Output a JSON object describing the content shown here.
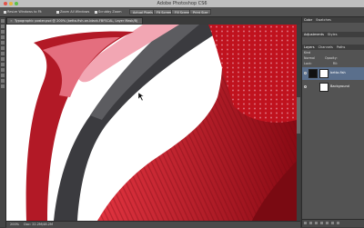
{
  "app": {
    "title": "Adobe Photoshop CS6"
  },
  "options_bar": {
    "resize_windows": "Resize Windows to Fit",
    "zoom_all_windows": "Zoom All Windows",
    "scrubby_zoom": "Scrubby Zoom",
    "actual_pixels": "Actual Pixels",
    "fit_screen": "Fit Screen",
    "fill_screen": "Fill Screen",
    "print_size": "Print Size"
  },
  "document": {
    "tab_label": "Typographic poster.psd @ 200% (betta-fish-on-black-FBFSCAL, Layer Mask/8)"
  },
  "status": {
    "zoom": "200%",
    "doc_size": "Doc: 22.2M/48.2M"
  },
  "panels": {
    "top_tabs": [
      "Color",
      "Swatches"
    ],
    "adj_tabs": [
      "Adjustments",
      "Styles"
    ],
    "layer_tabs": [
      "Layers",
      "Channels",
      "Paths"
    ],
    "kind": "Kind",
    "blend_mode": "Normal",
    "opacity_label": "Opacity:",
    "lock_label": "Lock:",
    "fill_label": "Fill:",
    "layers": [
      {
        "name": "betta-fish",
        "selected": true
      },
      {
        "name": "Background",
        "selected": false
      }
    ]
  },
  "colors": {
    "fish_red": "#c0121e",
    "selection": "#5a6f8c"
  }
}
